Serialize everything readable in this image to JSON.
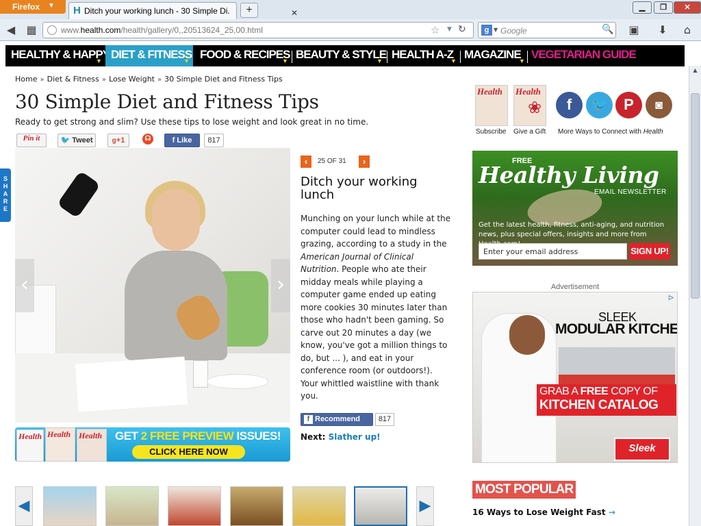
{
  "browser": {
    "menu_label": "Firefox",
    "tab_title": "Ditch your working lunch - 30 Simple Di...",
    "tab_favicon": "H",
    "url_prefix": "www.",
    "url_domain": "health.com",
    "url_path": "/health/gallery/0,,20513624_25,00.html",
    "search_placeholder": "Google",
    "search_engine": "g",
    "new_tab": "+",
    "tab_close": "✕",
    "win_min": "▁",
    "win_max": "❐",
    "win_close": "✕"
  },
  "sitenav": {
    "items": [
      {
        "label": "HEALTHY & HAPPY"
      },
      {
        "label": "DIET & FITNESS"
      },
      {
        "label": "FOOD & RECIPES"
      },
      {
        "label": "BEAUTY & STYLE"
      },
      {
        "label": "HEALTH A-Z"
      },
      {
        "label": "MAGAZINE"
      },
      {
        "label": "VEGETARIAN GUIDE"
      }
    ],
    "accent": "#2aa0c8",
    "highlight_color": "#e31b8d"
  },
  "breadcrumb": {
    "items": [
      "Home",
      "Diet & Fitness",
      "Lose Weight",
      "30 Simple Diet and Fitness Tips"
    ],
    "separator": "»"
  },
  "page": {
    "title": "30 Simple Diet and Fitness Tips",
    "subtitle": "Ready to get strong and slim? Use these tips to lose weight and look great in no time."
  },
  "share": {
    "pin_label": "Pin it",
    "tweet_label": "Tweet",
    "gplus_label": "+1",
    "like_label": "Like",
    "like_count": "817",
    "side_tab": "SHARE"
  },
  "article": {
    "pager_prev": "‹",
    "pager_next": "›",
    "pager_text": "25 OF 31",
    "title": "Ditch your working lunch",
    "body_1": "Munching on your lunch while at the computer could lead to mindless grazing, according to a study in the ",
    "body_journal": "American Journal of Clinical Nutrition",
    "body_2": ". People who ate their midday meals while playing a computer game ended up eating more cookies 30 minutes later than those who hadn't been gaming. So carve out 20 minutes a day (we know, you've got a million things to do, but ... ), and eat in your conference room (or outdoors!). Your whittled waistline with thank you.",
    "recommend_label": "Recommend",
    "recommend_count": "817",
    "next_label": "Next:",
    "next_link": "Slather up!"
  },
  "promo": {
    "mag_logo": "Health",
    "headline_1": "GET ",
    "headline_2": "2 FREE PREVIEW",
    "headline_3": " ISSUES!",
    "cta": "CLICK HERE NOW"
  },
  "rightrail": {
    "subscribe_label": "Subscribe",
    "gift_label": "Give a Gift",
    "mag_logo": "Health",
    "more_ways_1": "More Ways to Connect with ",
    "more_ways_2": "Health",
    "newsletter": {
      "free": "FREE",
      "title": "Healthy Living",
      "subtitle": "EMAIL NEWSLETTER",
      "desc": "Get the latest health, fitness, anti-aging, and nutrition news, plus special offers, insights and more from Health.com!",
      "email_placeholder": "Enter your email address",
      "signup": "SIGN UP!"
    },
    "ad_label": "Advertisement",
    "ad": {
      "sleek": "SLEEK",
      "modular": "MODULAR KITCHEN",
      "grab_1": "GRAB A ",
      "grab_free": "FREE",
      "grab_2": " COPY OF",
      "catalog": "KITCHEN CATALOG",
      "brand": "Sleek"
    },
    "most_popular": "MOST POPULAR",
    "most_popular_item": "16 Ways to Lose Weight Fast"
  }
}
